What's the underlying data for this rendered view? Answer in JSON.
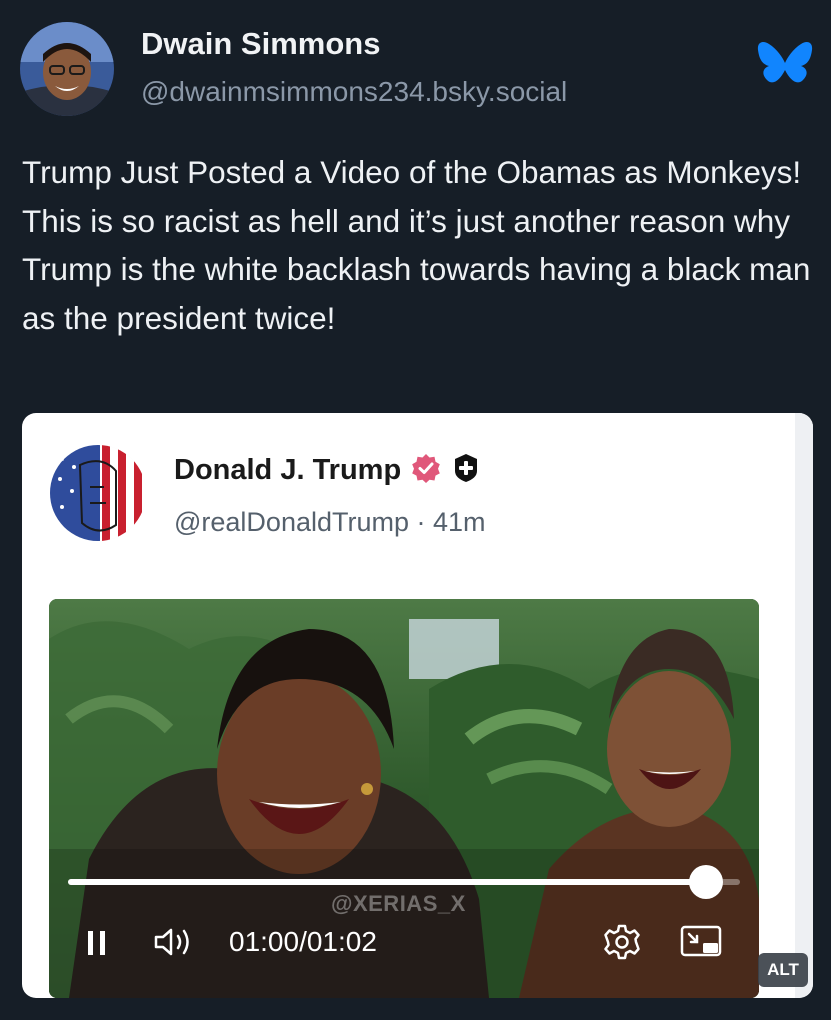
{
  "post": {
    "author_name": "Dwain Simmons",
    "author_handle": "@dwainmsimmons234.bsky.social",
    "text": "Trump Just Posted a Video of the Obamas as Monkeys! This is so racist as hell and it’s just another reason why Trump is the white backlash towards having a black man as the president twice!"
  },
  "quoted_post": {
    "author_name": "Donald J. Trump",
    "handle_time": "@realDonaldTrump · 41m"
  },
  "video": {
    "watermark": "@XERIAS_X",
    "time_readout": "01:00/01:02",
    "progress_fraction": 0.95
  },
  "alt_badge": "ALT",
  "icons": {
    "logo": "bluesky-butterfly-icon",
    "verified": "verified-badge-icon",
    "plus": "plus-badge-icon",
    "pause": "pause-icon",
    "volume": "volume-icon",
    "settings": "gear-icon",
    "pip": "picture-in-picture-icon"
  },
  "colors": {
    "background": "#161e27",
    "bluesky_blue": "#1185fe",
    "verified_pink": "#e0577a"
  }
}
